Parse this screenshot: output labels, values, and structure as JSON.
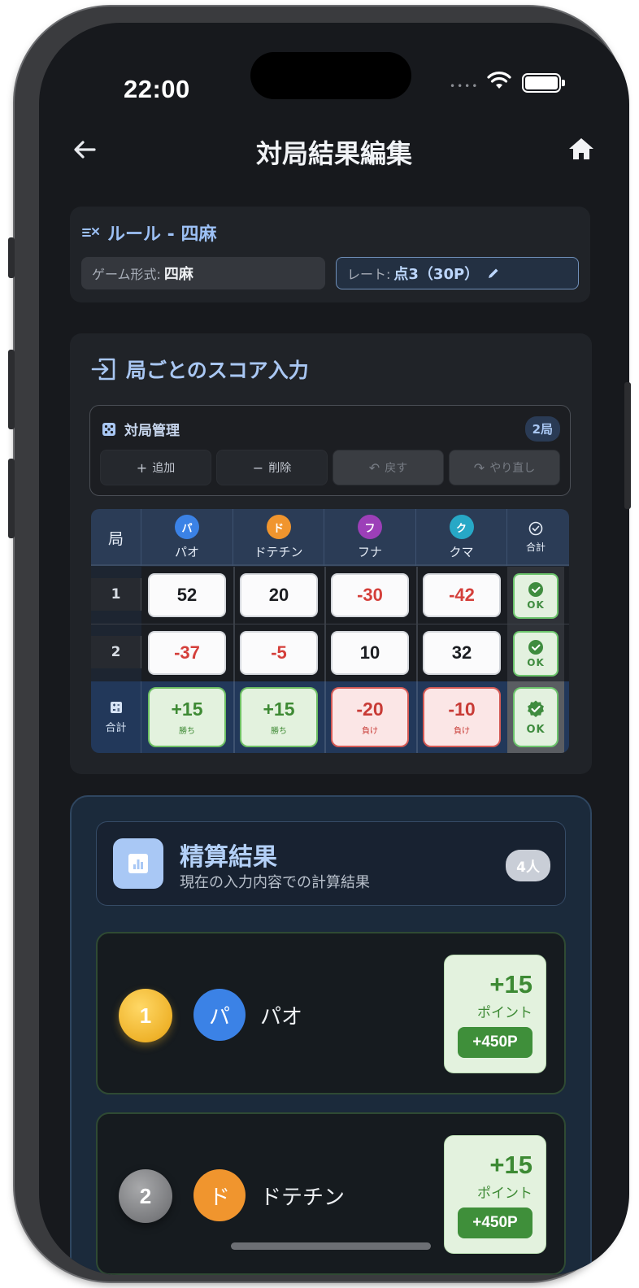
{
  "status": {
    "time": "22:00",
    "signal": "••••"
  },
  "appbar": {
    "title": "対局結果編集"
  },
  "rule": {
    "title": "ルール - 四麻",
    "game_type_label": "ゲーム形式:",
    "game_type_value": "四麻",
    "rate_label": "レート:",
    "rate_value": "点3（30P）"
  },
  "score_input": {
    "title": "局ごとのスコア入力",
    "management": {
      "title": "対局管理",
      "count_badge": "2局",
      "buttons": {
        "add": "追加",
        "delete": "削除",
        "undo": "戻す",
        "redo": "やり直し"
      }
    },
    "table": {
      "kyoku_header": "局",
      "total_header": "合計",
      "players": [
        {
          "initial": "パ",
          "name": "パオ",
          "color": "#3b82e6"
        },
        {
          "initial": "ド",
          "name": "ドテチン",
          "color": "#f0952e"
        },
        {
          "initial": "フ",
          "name": "フナ",
          "color": "#9c3fb8"
        },
        {
          "initial": "ク",
          "name": "クマ",
          "color": "#27a8c6"
        }
      ],
      "rows": [
        {
          "number": "1",
          "scores": [
            "52",
            "20",
            "-30",
            "-42"
          ],
          "status": "OK"
        },
        {
          "number": "2",
          "scores": [
            "-37",
            "-5",
            "10",
            "32"
          ],
          "status": "OK"
        }
      ],
      "totals": {
        "label": "合計",
        "values": [
          "+15",
          "+15",
          "-20",
          "-10"
        ],
        "results": [
          "勝ち",
          "勝ち",
          "負け",
          "負け"
        ],
        "status": "OK"
      }
    }
  },
  "settlement": {
    "title": "精算結果",
    "subtitle": "現在の入力内容での計算結果",
    "people_badge": "4人",
    "players": [
      {
        "rank": "1",
        "initial": "パ",
        "name": "パオ",
        "points": "+15",
        "unit": "ポイント",
        "money": "+450P",
        "avatar_color": "#3b82e6"
      },
      {
        "rank": "2",
        "initial": "ド",
        "name": "ドテチン",
        "points": "+15",
        "unit": "ポイント",
        "money": "+450P",
        "avatar_color": "#f0952e"
      }
    ]
  }
}
